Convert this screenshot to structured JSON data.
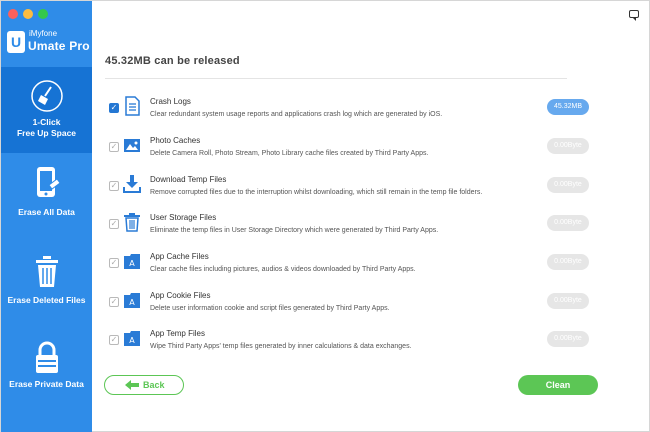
{
  "window": {
    "traffic_lights": [
      "close",
      "minimize",
      "maximize"
    ]
  },
  "brand": {
    "small": "iMyfone",
    "name": "Umate Pro",
    "logo_glyph": "U"
  },
  "sidebar": {
    "items": [
      {
        "line1": "1-Click",
        "line2": "Free Up Space",
        "icon": "broom-icon",
        "active": true
      },
      {
        "line1": "Erase All Data",
        "icon": "phone-erase-icon",
        "active": false
      },
      {
        "line1": "Erase Deleted Files",
        "icon": "trash-icon",
        "active": false
      },
      {
        "line1": "Erase Private Data",
        "icon": "lock-icon",
        "active": false
      }
    ]
  },
  "main": {
    "title": "45.32MB can be released",
    "items": [
      {
        "title": "Crash Logs",
        "desc": "Clear redundant system usage reports and applications crash log which are generated by iOS.",
        "size": "45.32MB",
        "checked": true,
        "icon": "document-icon"
      },
      {
        "title": "Photo Caches",
        "desc": "Delete Camera Roll, Photo Stream, Photo Library cache files created by Third Party Apps.",
        "size": "0.00Byte",
        "checked": false,
        "icon": "photo-icon"
      },
      {
        "title": "Download Temp Files",
        "desc": "Remove corrupted files due to the interruption whilst downloading, which still remain in the temp file folders.",
        "size": "0.00Byte",
        "checked": false,
        "icon": "download-icon"
      },
      {
        "title": "User Storage Files",
        "desc": "Eliminate the temp files in User Storage Directory which were generated by Third Party Apps.",
        "size": "0.00Byte",
        "checked": false,
        "icon": "trash-can-icon"
      },
      {
        "title": "App Cache Files",
        "desc": "Clear cache files including pictures, audios & videos downloaded by Third Party Apps.",
        "size": "0.00Byte",
        "checked": false,
        "icon": "app-folder-icon"
      },
      {
        "title": "App Cookie Files",
        "desc": "Delete user information cookie and script files generated by Third Party Apps.",
        "size": "0.00Byte",
        "checked": false,
        "icon": "app-folder-icon"
      },
      {
        "title": "App Temp Files",
        "desc": "Wipe Third Party Apps' temp files generated by inner calculations & data exchanges.",
        "size": "0.00Byte",
        "checked": false,
        "icon": "app-folder-icon"
      }
    ]
  },
  "buttons": {
    "back": "Back",
    "clean": "Clean"
  },
  "colors": {
    "sidebar": "#2f8ce8",
    "sidebar_active": "#1673d4",
    "green": "#5cc655",
    "pill_active": "#67a9ee"
  }
}
